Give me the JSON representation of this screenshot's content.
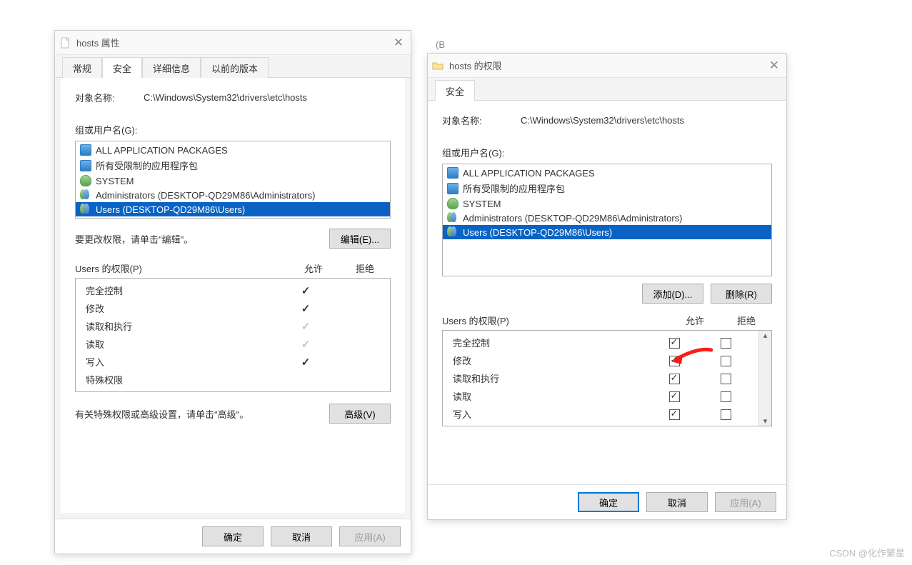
{
  "kb_stub": "(B",
  "dlg1": {
    "title": "hosts 属性",
    "tabs": [
      "常规",
      "安全",
      "详细信息",
      "以前的版本"
    ],
    "active_tab": 1,
    "object_label": "对象名称:",
    "object_path": "C:\\Windows\\System32\\drivers\\etc\\hosts",
    "group_label": "组或用户名(G):",
    "principals": [
      {
        "icon": "pkg",
        "label": "ALL APPLICATION PACKAGES"
      },
      {
        "icon": "pkg",
        "label": "所有受限制的应用程序包"
      },
      {
        "icon": "usr",
        "label": "SYSTEM"
      },
      {
        "icon": "grp",
        "label": "Administrators (DESKTOP-QD29M86\\Administrators)"
      },
      {
        "icon": "grp",
        "label": "Users (DESKTOP-QD29M86\\Users)"
      }
    ],
    "selected_principal": 4,
    "edit_hint": "要更改权限，请单击\"编辑\"。",
    "edit_btn": "编辑(E)...",
    "perm_header": {
      "name": "Users 的权限(P)",
      "allow": "允许",
      "deny": "拒绝"
    },
    "perms": [
      {
        "name": "完全控制",
        "allow": "v",
        "deny": ""
      },
      {
        "name": "修改",
        "allow": "v",
        "deny": ""
      },
      {
        "name": "读取和执行",
        "allow": "g",
        "deny": ""
      },
      {
        "name": "读取",
        "allow": "g",
        "deny": ""
      },
      {
        "name": "写入",
        "allow": "v",
        "deny": ""
      },
      {
        "name": "特殊权限",
        "allow": "",
        "deny": ""
      }
    ],
    "adv_hint": "有关特殊权限或高级设置，请单击\"高级\"。",
    "adv_btn": "高级(V)",
    "ok": "确定",
    "cancel": "取消",
    "apply": "应用(A)"
  },
  "dlg2": {
    "title": "hosts 的权限",
    "tabs": [
      "安全"
    ],
    "active_tab": 0,
    "object_label": "对象名称:",
    "object_path": "C:\\Windows\\System32\\drivers\\etc\\hosts",
    "group_label": "组或用户名(G):",
    "principals": [
      {
        "icon": "pkg",
        "label": "ALL APPLICATION PACKAGES"
      },
      {
        "icon": "pkg",
        "label": "所有受限制的应用程序包"
      },
      {
        "icon": "usr",
        "label": "SYSTEM"
      },
      {
        "icon": "grp",
        "label": "Administrators (DESKTOP-QD29M86\\Administrators)"
      },
      {
        "icon": "grp",
        "label": "Users (DESKTOP-QD29M86\\Users)"
      }
    ],
    "selected_principal": 4,
    "add_btn": "添加(D)...",
    "remove_btn": "删除(R)",
    "perm_header": {
      "name": "Users 的权限(P)",
      "allow": "允许",
      "deny": "拒绝"
    },
    "perms": [
      {
        "name": "完全控制",
        "allow": true,
        "deny": false
      },
      {
        "name": "修改",
        "allow": true,
        "deny": false
      },
      {
        "name": "读取和执行",
        "allow": true,
        "deny": false
      },
      {
        "name": "读取",
        "allow": true,
        "deny": false
      },
      {
        "name": "写入",
        "allow": true,
        "deny": false
      }
    ],
    "ok": "确定",
    "cancel": "取消",
    "apply": "应用(A)"
  },
  "watermark": "CSDN @化作繁星"
}
